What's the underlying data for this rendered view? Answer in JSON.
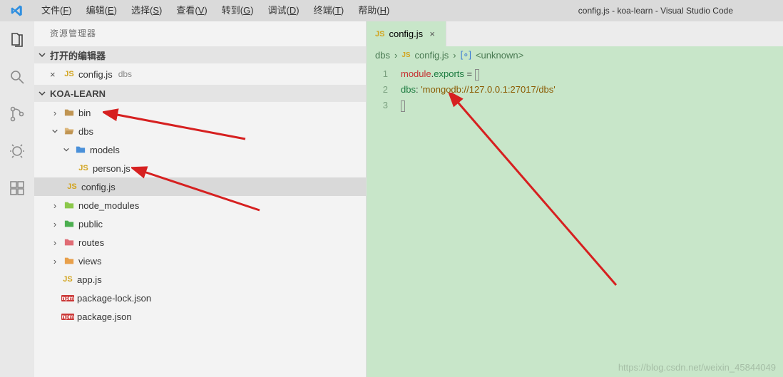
{
  "window": {
    "title": "config.js - koa-learn - Visual Studio Code"
  },
  "menubar": {
    "items": [
      {
        "pre": "文件(",
        "u": "F",
        "post": ")"
      },
      {
        "pre": "编辑(",
        "u": "E",
        "post": ")"
      },
      {
        "pre": "选择(",
        "u": "S",
        "post": ")"
      },
      {
        "pre": "查看(",
        "u": "V",
        "post": ")"
      },
      {
        "pre": "转到(",
        "u": "G",
        "post": ")"
      },
      {
        "pre": "调试(",
        "u": "D",
        "post": ")"
      },
      {
        "pre": "终端(",
        "u": "T",
        "post": ")"
      },
      {
        "pre": "帮助(",
        "u": "H",
        "post": ")"
      }
    ]
  },
  "sidebar": {
    "explorer_title": "资源管理器",
    "open_editors_label": "打开的编辑器",
    "workspace_label": "KOA-LEARN",
    "open_editors": [
      {
        "icon": "JS",
        "name": "config.js",
        "path": "dbs"
      }
    ],
    "tree": {
      "bin": "bin",
      "dbs": "dbs",
      "models": "models",
      "person": "person.js",
      "config": "config.js",
      "node_modules": "node_modules",
      "public": "public",
      "routes": "routes",
      "views": "views",
      "app": "app.js",
      "pkglock": "package-lock.json",
      "pkg": "package.json"
    }
  },
  "tab": {
    "icon": "JS",
    "name": "config.js"
  },
  "breadcrumbs": {
    "seg1": "dbs",
    "seg2": "config.js",
    "seg3": "<unknown>",
    "icon": "JS"
  },
  "code": {
    "line1": {
      "a": "module",
      "b": ".",
      "c": "exports",
      "d": " = "
    },
    "line2": {
      "indent": "    ",
      "key": "dbs",
      "colon": ": ",
      "str": "'mongodb://127.0.0.1:27017/dbs'"
    },
    "lineno": {
      "l1": "1",
      "l2": "2",
      "l3": "3"
    }
  },
  "icons": {
    "close": "×",
    "js": "JS",
    "npm": "npm"
  },
  "watermark": "https://blog.csdn.net/weixin_45844049"
}
